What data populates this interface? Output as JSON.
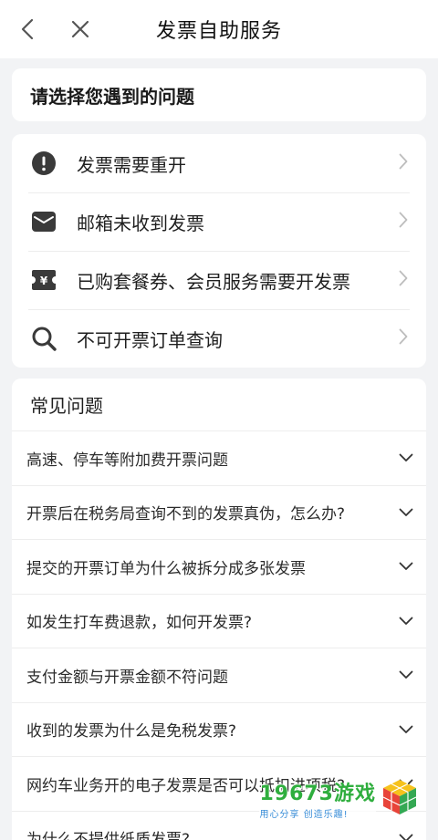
{
  "nav": {
    "title": "发票自助服务",
    "back_icon": "back-arrow-icon",
    "close_icon": "close-icon"
  },
  "prompt": {
    "title": "请选择您遇到的问题"
  },
  "issues": [
    {
      "label": "发票需要重开",
      "icon": "exclamation-icon"
    },
    {
      "label": "邮箱未收到发票",
      "icon": "mail-icon"
    },
    {
      "label": "已购套餐券、会员服务需要开发票",
      "icon": "yen-ticket-icon"
    },
    {
      "label": "不可开票订单查询",
      "icon": "search-icon"
    }
  ],
  "faq": {
    "title": "常见问题",
    "items": [
      "高速、停车等附加费开票问题",
      "开票后在税务局查询不到的发票真伪，怎么办?",
      "提交的开票订单为什么被拆分成多张发票",
      "如发生打车费退款，如何开发票?",
      "支付金额与开票金额不符问题",
      "收到的发票为什么是免税发票?",
      "网约车业务开的电子发票是否可以抵扣进项税?",
      "为什么不提供纸质发票?"
    ]
  },
  "watermark": {
    "main": "19673游戏",
    "sub": "用心分享 创造乐趣!"
  },
  "colors": {
    "background": "#f2f3f5",
    "card": "#ffffff",
    "icon": "#3a3a3a",
    "chevron": "#bdbdbd",
    "watermark_green": "#2fae3e"
  }
}
